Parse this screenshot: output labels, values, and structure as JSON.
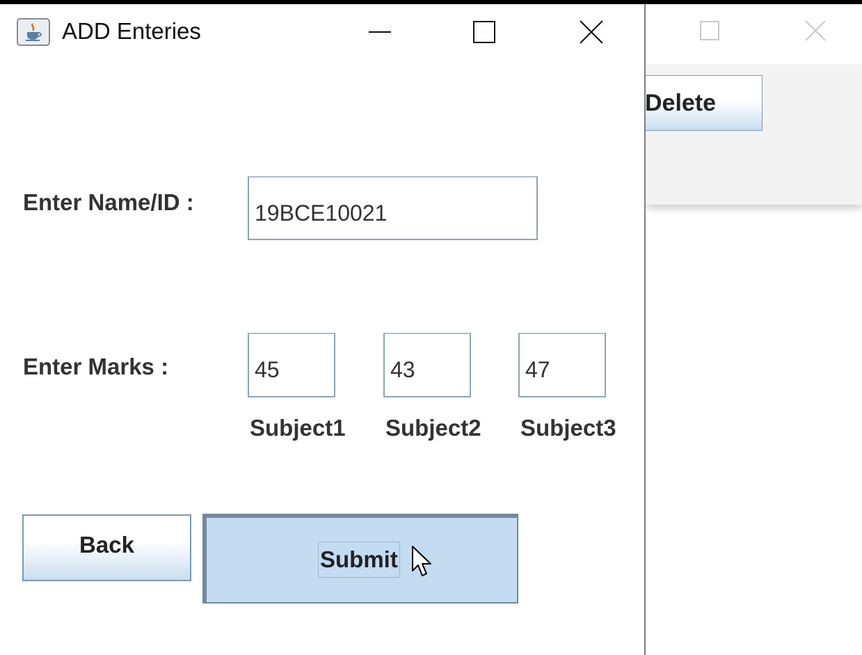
{
  "background_window": {
    "delete_button": "Delete"
  },
  "window": {
    "title": "ADD Enteries",
    "icon": "java-app-icon"
  },
  "form": {
    "name_label": "Enter Name/ID :",
    "name_value": "19BCE10021",
    "marks_label": "Enter Marks :",
    "marks": [
      {
        "value": "45",
        "subject": "Subject1"
      },
      {
        "value": "43",
        "subject": "Subject2"
      },
      {
        "value": "47",
        "subject": "Subject3"
      }
    ]
  },
  "buttons": {
    "back": "Back",
    "submit": "Submit"
  },
  "colors": {
    "button_gradient_end": "#c9ddf0",
    "submit_pressed": "#c4dcf2",
    "field_border": "#8aa4bc",
    "label_text": "#333333"
  }
}
